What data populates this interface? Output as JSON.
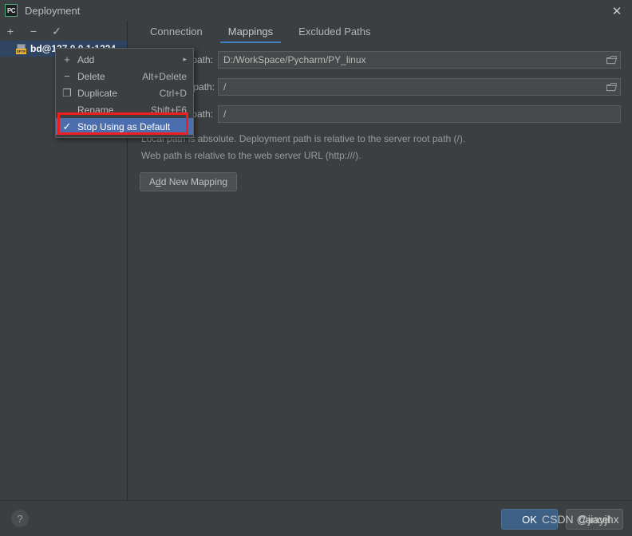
{
  "window": {
    "title": "Deployment",
    "logo_text": "PC",
    "close_icon": "close-icon"
  },
  "sidebar": {
    "toolbar": [
      {
        "name": "add-server-button",
        "glyph": "+"
      },
      {
        "name": "remove-server-button",
        "glyph": "−"
      },
      {
        "name": "use-as-default-button",
        "glyph": "✓"
      }
    ],
    "tree_items": [
      {
        "label": "bd@127.0.0.1:1234",
        "icon": "sftp-icon",
        "icon_label": "SFTP",
        "selected": true
      }
    ]
  },
  "tabs": [
    {
      "label": "Connection",
      "active": false
    },
    {
      "label": "Mappings",
      "active": true
    },
    {
      "label": "Excluded Paths",
      "active": false
    }
  ],
  "mappings": {
    "rows": [
      {
        "label": "Local path:",
        "value": "D:/WorkSpace/Pycharm/PY_linux",
        "browse_icon": "folder-icon"
      },
      {
        "label": "Deployment path:",
        "value": "/",
        "browse_icon": "folder-icon"
      },
      {
        "label": "Web path:",
        "value": "/",
        "browse_icon": ""
      }
    ],
    "hint_line_1": "Local path is absolute. Deployment path is relative to the server root path (/).",
    "hint_line_2": "Web path is relative to the web server URL (http:///).",
    "add_mapping_prefix": "A",
    "add_mapping_mnemonic": "d",
    "add_mapping_suffix": "d New Mapping",
    "add_mapping_label": "Add New Mapping"
  },
  "context_menu": {
    "items": [
      {
        "icon": "plus-icon",
        "glyph": "+",
        "label": "Add",
        "accel": "",
        "arrow": "▸",
        "selected": false,
        "checked": false
      },
      {
        "icon": "minus-icon",
        "glyph": "−",
        "label": "Delete",
        "accel": "Alt+Delete",
        "arrow": "",
        "selected": false,
        "checked": false
      },
      {
        "icon": "duplicate-icon",
        "glyph": "❐",
        "label": "Duplicate",
        "accel": "Ctrl+D",
        "arrow": "",
        "selected": false,
        "checked": false
      },
      {
        "icon": "rename-icon",
        "glyph": "",
        "label": "Rename",
        "accel": "Shift+F6",
        "arrow": "",
        "selected": false,
        "checked": false
      },
      {
        "icon": "check-icon",
        "glyph": "✓",
        "label": "Stop Using as Default",
        "accel": "",
        "arrow": "",
        "selected": true,
        "checked": true
      }
    ]
  },
  "bottom": {
    "help_glyph": "?",
    "ok_label": "OK",
    "cancel_label": "Cancel"
  },
  "watermark": "CSDN @jiayjhx",
  "colors": {
    "background": "#3c3f41",
    "selection_blue": "#4b6eaf",
    "tab_underline": "#3d7ec4",
    "tree_selection": "#2f4562",
    "highlight_red": "#f01f1f",
    "ok_button": "#3d6185",
    "sftp_badge": "#e8b339"
  }
}
